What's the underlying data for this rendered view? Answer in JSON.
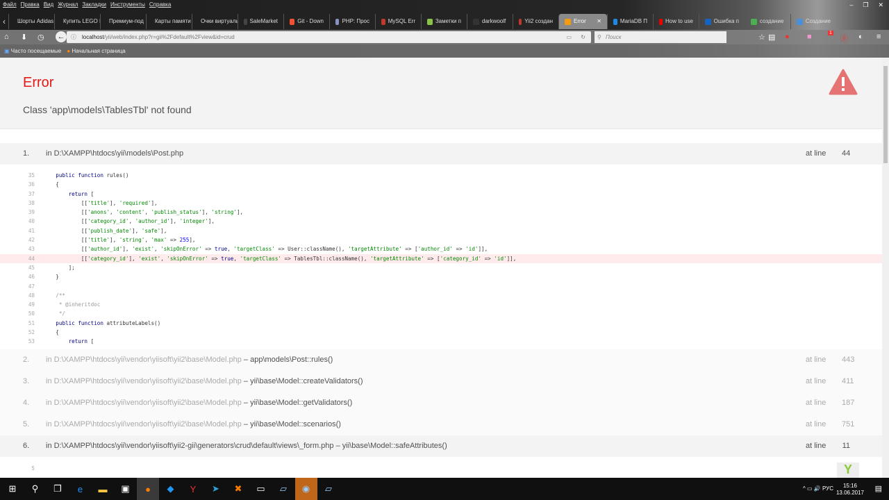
{
  "browser": {
    "menu": [
      "Файл",
      "Правка",
      "Вид",
      "Журнал",
      "Закладки",
      "Инструменты",
      "Справка"
    ],
    "tabs": [
      {
        "label": "Шорты Adidas",
        "color": "#444"
      },
      {
        "label": "Купить LEGO I",
        "color": "#444"
      },
      {
        "label": "Премиум-под",
        "color": "#444"
      },
      {
        "label": "Карты памяти",
        "color": "#444"
      },
      {
        "label": "Очки виртуаль",
        "color": "#444"
      },
      {
        "label": "SaleMarket",
        "color": "#444"
      },
      {
        "label": "Git - Down",
        "color": "#f05133"
      },
      {
        "label": "PHP: Проc",
        "color": "#8892bf"
      },
      {
        "label": "MySQL Err",
        "color": "#c0392b"
      },
      {
        "label": "Заметки п",
        "color": "#8bc34a"
      },
      {
        "label": "darkwoolf",
        "color": "#333"
      },
      {
        "label": "Yii2 создан",
        "color": "#c0392b"
      },
      {
        "label": "Error",
        "color": "#f39c12",
        "active": true
      },
      {
        "label": "MariaDB П",
        "color": "#1e88e5"
      },
      {
        "label": "How to use",
        "color": "#e00"
      },
      {
        "label": "Ошибка п",
        "color": "#1565c0"
      },
      {
        "label": "создание",
        "color": "#4caf50"
      },
      {
        "label": "Создание",
        "color": "#4a90d9"
      }
    ],
    "url_host": "localhost",
    "url_rest": "/yii/web/index.php?r=gii%2Fdefault%2Fview&id=crud",
    "search_placeholder": "Поиск",
    "bookmarks": [
      "Часто посещаемые",
      "Начальная страница"
    ],
    "notification_badge": "1"
  },
  "error": {
    "title": "Error",
    "message": "Class 'app\\models\\TablesTbl' not found"
  },
  "stack": [
    {
      "n": "1.",
      "file": "in D:\\XAMPP\\htdocs\\yii\\models\\Post.php",
      "call": "",
      "at": "at line",
      "line": "44",
      "app": true
    },
    {
      "n": "2.",
      "file": "in D:\\XAMPP\\htdocs\\yii\\vendor\\yiisoft\\yii2\\base\\Model.php",
      "call": " – app\\models\\Post::rules()",
      "at": "at line",
      "line": "443"
    },
    {
      "n": "3.",
      "file": "in D:\\XAMPP\\htdocs\\yii\\vendor\\yiisoft\\yii2\\base\\Model.php",
      "call": " – yii\\base\\Model::createValidators()",
      "at": "at line",
      "line": "411"
    },
    {
      "n": "4.",
      "file": "in D:\\XAMPP\\htdocs\\yii\\vendor\\yiisoft\\yii2\\base\\Model.php",
      "call": " – yii\\base\\Model::getValidators()",
      "at": "at line",
      "line": "187"
    },
    {
      "n": "5.",
      "file": "in D:\\XAMPP\\htdocs\\yii\\vendor\\yiisoft\\yii2\\base\\Model.php",
      "call": " – yii\\base\\Model::scenarios()",
      "at": "at line",
      "line": "751"
    },
    {
      "n": "6.",
      "file": "in D:\\XAMPP\\htdocs\\yii\\vendor\\yiisoft\\yii2-gii\\generators\\crud\\default\\views\\_form.php – yii\\base\\Model::safeAttributes()",
      "call": "",
      "at": "at line",
      "line": "11",
      "app": true
    }
  ],
  "code": {
    "error_line": "44",
    "lines": [
      [
        "35",
        "    public function rules()"
      ],
      [
        "36",
        "    {"
      ],
      [
        "37",
        "        return ["
      ],
      [
        "38",
        "            [['title'], 'required'],"
      ],
      [
        "39",
        "            [['anons', 'content', 'publish_status'], 'string'],"
      ],
      [
        "40",
        "            [['category_id', 'author_id'], 'integer'],"
      ],
      [
        "41",
        "            [['publish_date'], 'safe'],"
      ],
      [
        "42",
        "            [['title'], 'string', 'max' => 255],"
      ],
      [
        "43",
        "            [['author_id'], 'exist', 'skipOnError' => true, 'targetClass' => User::className(), 'targetAttribute' => ['author_id' => 'id']],"
      ],
      [
        "44",
        "            [['category_id'], 'exist', 'skipOnError' => true, 'targetClass' => TablesTbl::className(), 'targetAttribute' => ['category_id' => 'id']],"
      ],
      [
        "45",
        "        ];"
      ],
      [
        "46",
        "    }"
      ],
      [
        "47",
        ""
      ],
      [
        "48",
        "    /**"
      ],
      [
        "49",
        "     * @inheritdoc"
      ],
      [
        "50",
        "     */"
      ],
      [
        "51",
        "    public function attributeLabels()"
      ],
      [
        "52",
        "    {"
      ],
      [
        "53",
        "        return ["
      ]
    ]
  },
  "next_code_line": "5",
  "taskbar": {
    "icons": [
      "windows-start",
      "search",
      "task-view",
      "edge",
      "file-explorer",
      "store",
      "firefox",
      "vscode",
      "yandex",
      "telegram",
      "xampp",
      "terminal",
      "notepad",
      "steam",
      "notepad2"
    ],
    "lang": "РУС",
    "time": "15:16",
    "date": "13.06.2017"
  }
}
